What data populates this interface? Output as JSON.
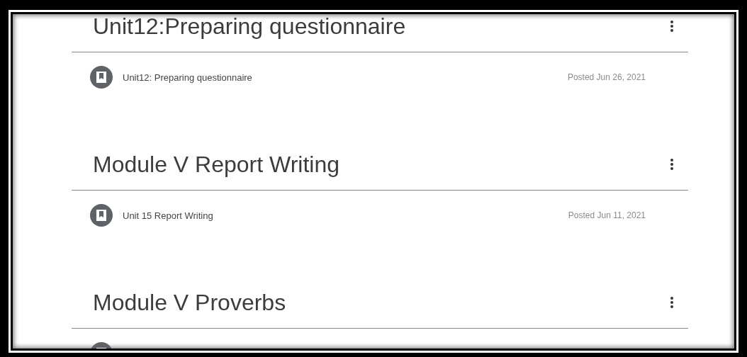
{
  "topics": [
    {
      "title": "Unit12:Preparing questionnaire",
      "materials": [
        {
          "kind": "material",
          "title": "Unit12: Preparing questionnaire",
          "posted": "Posted Jun 26, 2021"
        }
      ]
    },
    {
      "title": "Module V Report Writing",
      "materials": [
        {
          "kind": "material",
          "title": "Unit 15 Report Writing",
          "posted": "Posted Jun 11, 2021"
        }
      ]
    },
    {
      "title": "Module V Proverbs",
      "materials": [
        {
          "kind": "material"
        }
      ]
    }
  ]
}
